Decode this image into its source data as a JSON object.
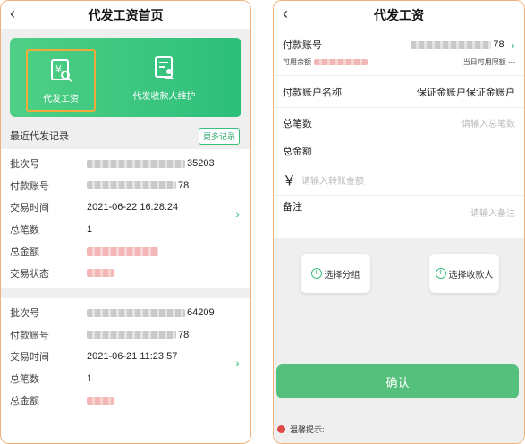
{
  "home": {
    "title": "代发工资首页",
    "back_icon": "chevron-left-icon",
    "banner": {
      "pay_label": "代发工资",
      "pay_icon": "yen-document-icon",
      "maintain_label": "代发收款人维护",
      "maintain_icon": "user-document-icon"
    },
    "recent_title": "最近代发记录",
    "more_label": "更多记录",
    "records": [
      {
        "batch_label": "批次号",
        "batch_value": "35203",
        "account_label": "付款账号",
        "account_value": "78",
        "time_label": "交易时间",
        "time_value": "2021-06-22 16:28:24",
        "count_label": "总笔数",
        "count_value": "1",
        "amount_label": "总金额",
        "status_label": "交易状态"
      },
      {
        "batch_label": "批次号",
        "batch_value": "64209",
        "account_label": "付款账号",
        "account_value": "78",
        "time_label": "交易时间",
        "time_value": "2021-06-21 11:23:57",
        "count_label": "总笔数",
        "count_value": "1",
        "amount_label": "总金额"
      }
    ]
  },
  "form": {
    "title": "代发工资",
    "back_icon": "chevron-left-icon",
    "account_label": "付款账号",
    "account_value": "78",
    "balance_label": "可用余额",
    "daily_limit_label": "当日可用限额 ---",
    "account_name_label": "付款账户名称",
    "account_name_value": "保证金账户保证金账户",
    "count_label": "总笔数",
    "count_placeholder": "请输入总笔数",
    "amount_label": "总金额",
    "currency_symbol": "￥",
    "amount_placeholder": "请输入转账金额",
    "note_label": "备注",
    "note_placeholder": "请输入备注",
    "select_group_label": "选择分组",
    "select_payee_label": "选择收款人",
    "confirm_label": "确认",
    "tip_label": "温馨提示:"
  },
  "colors": {
    "accent_green": "#3bbf7c",
    "banner_green": "#2cbf7a",
    "highlight_orange": "#f0a93a",
    "warning_red": "#e04848"
  }
}
